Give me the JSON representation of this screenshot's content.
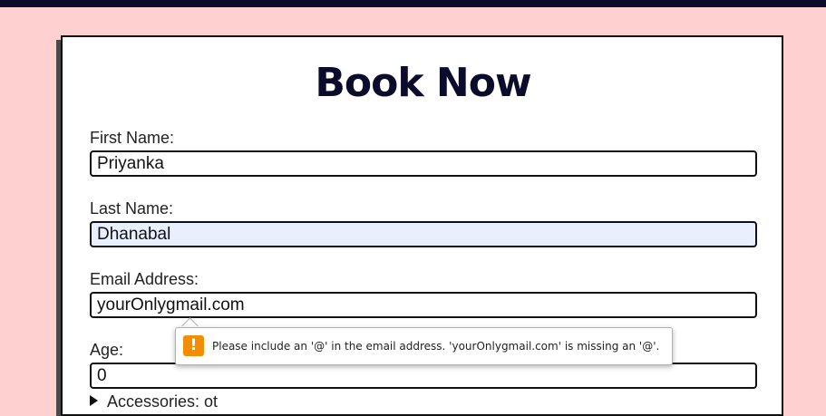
{
  "page": {
    "title": "Book Now"
  },
  "form": {
    "first_name": {
      "label": "First Name:",
      "value": "Priyanka"
    },
    "last_name": {
      "label": "Last Name:",
      "value": "Dhanabal"
    },
    "email": {
      "label": "Email Address:",
      "value": "yourOnlygmail.com"
    },
    "age": {
      "label": "Age:",
      "value": "0"
    },
    "accessories": {
      "label": "Accessories: ot"
    }
  },
  "validation": {
    "icon": "!",
    "message": "Please include an '@' in the email address. 'yourOnlygmail.com' is missing an '@'."
  },
  "colors": {
    "background": "#ffd0d0",
    "topbar": "#0b0b2b",
    "autofill": "#e8f0fe",
    "warning": "#f28c00"
  }
}
